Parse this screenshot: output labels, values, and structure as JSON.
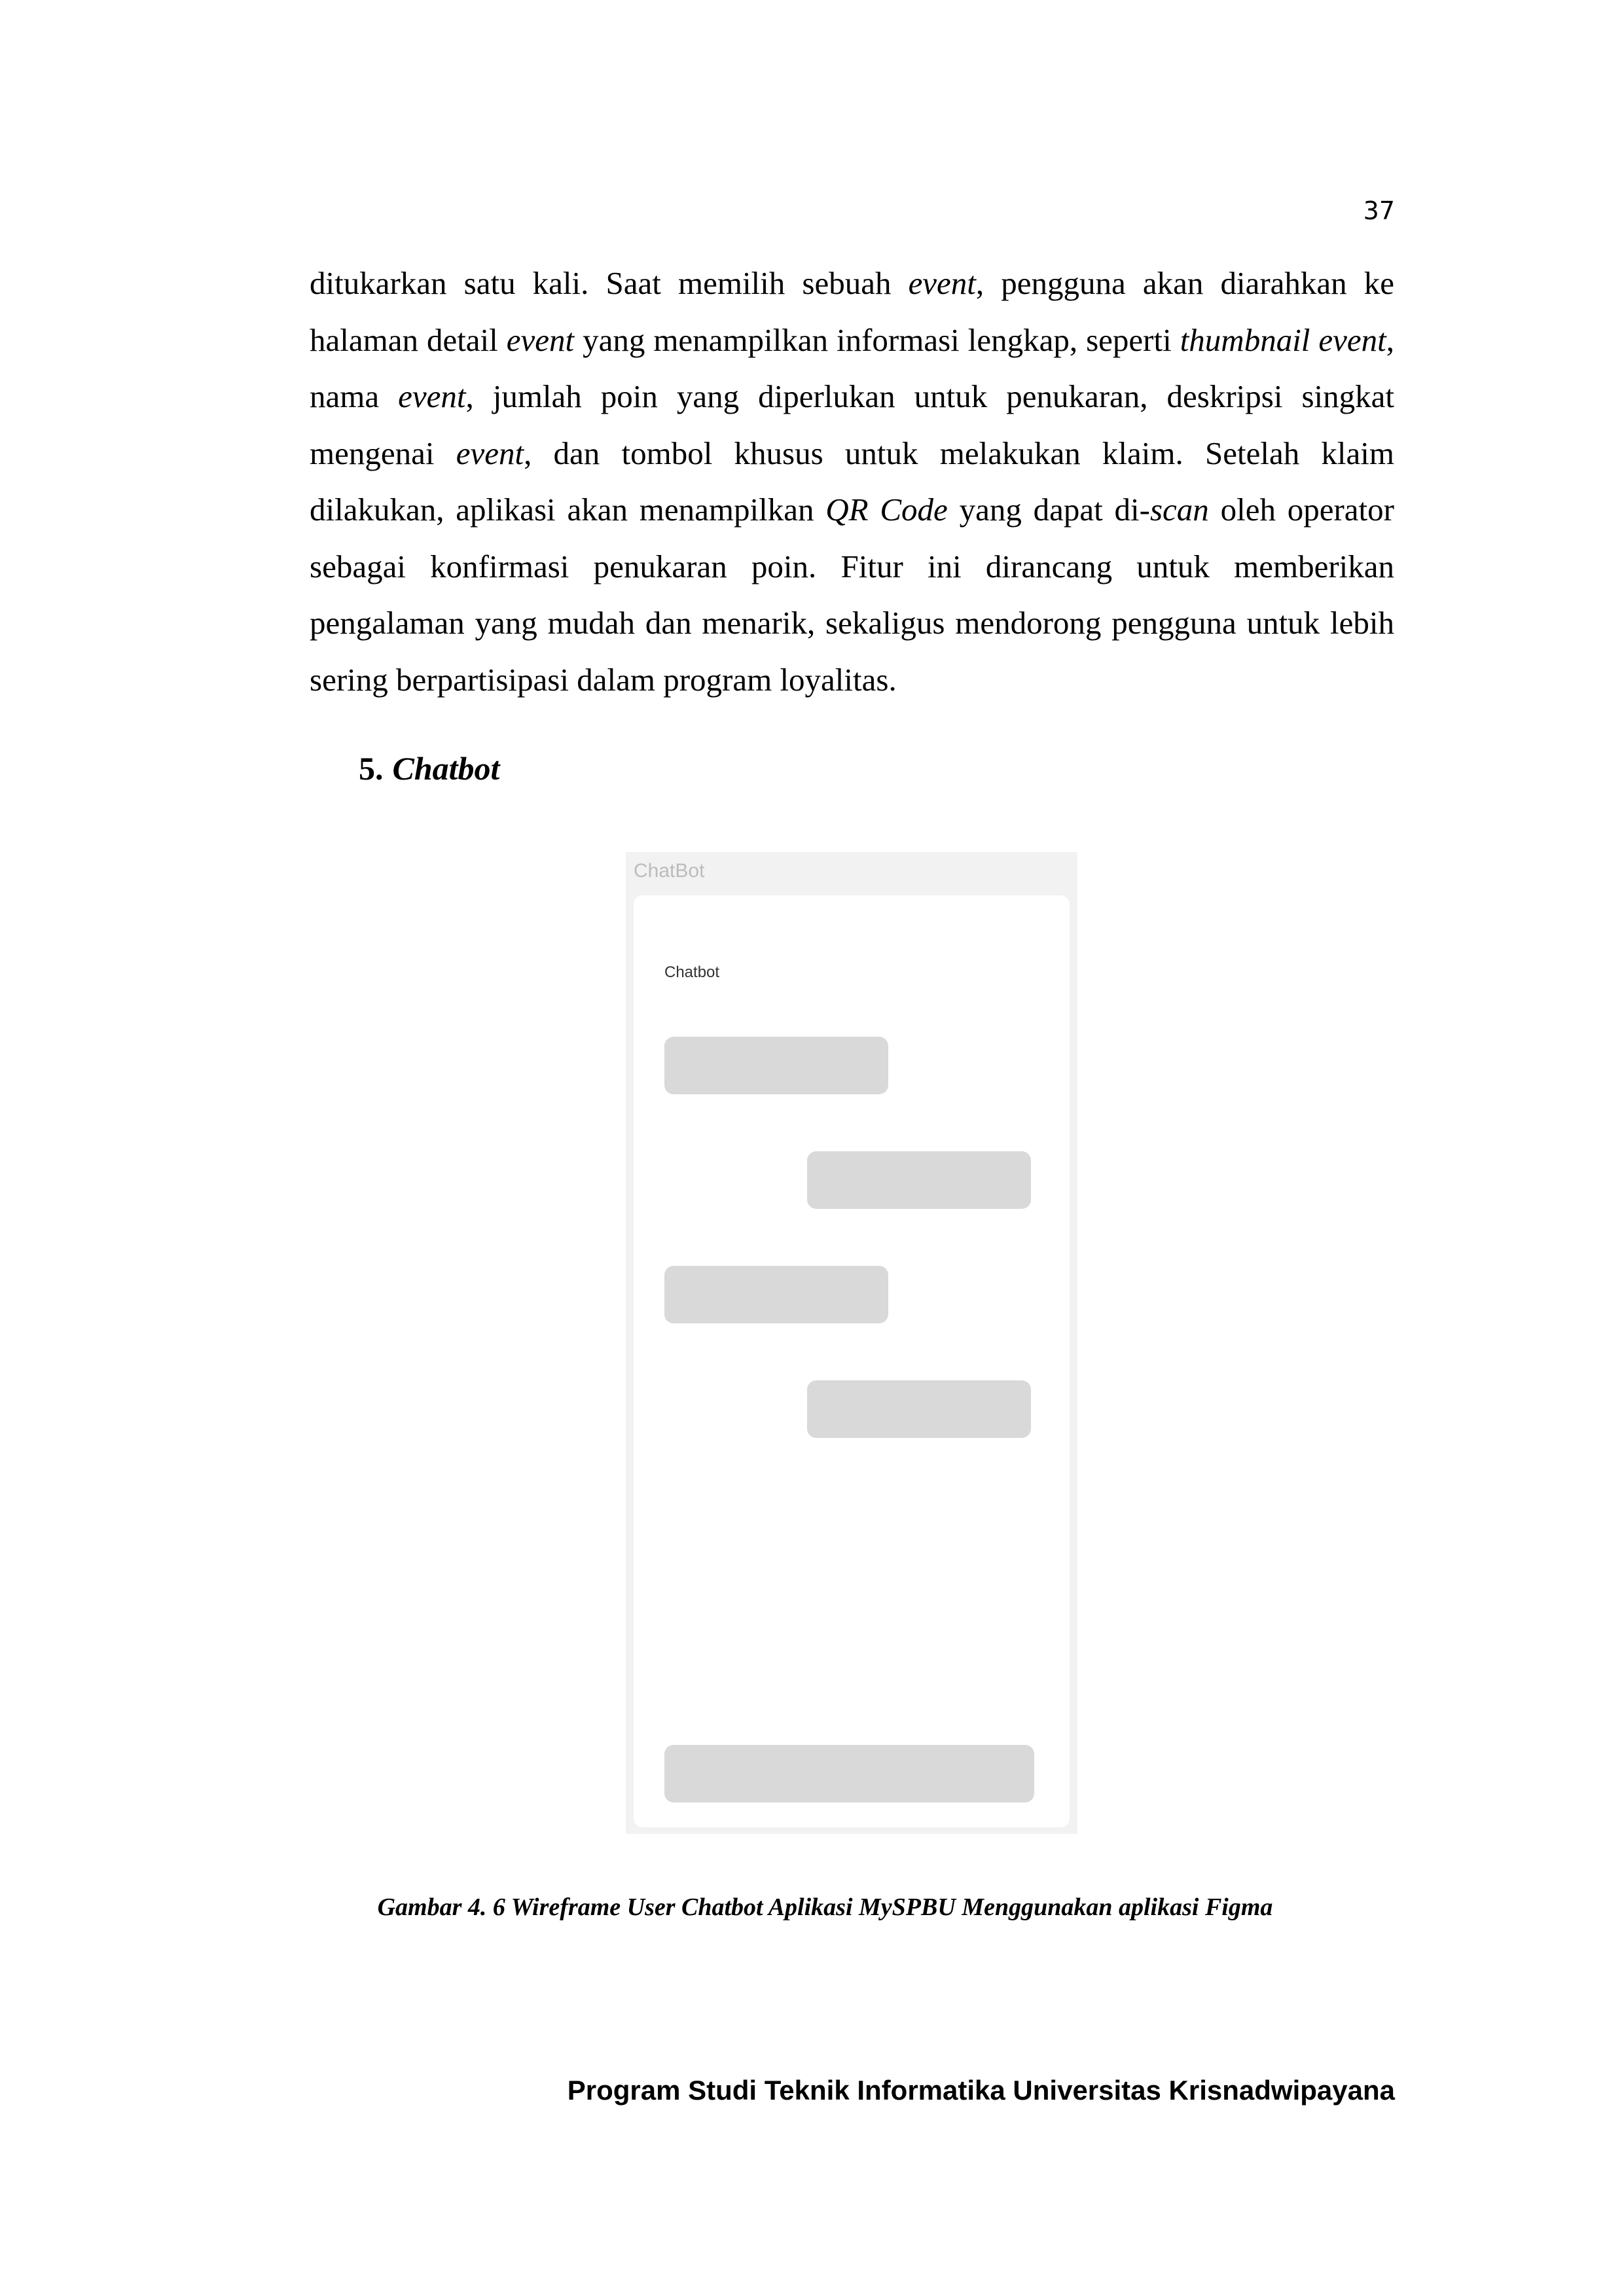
{
  "page_number": "37",
  "paragraph": [
    {
      "t": "ditukarkan satu kali. Saat memilih sebuah ",
      "i": false
    },
    {
      "t": "event",
      "i": true
    },
    {
      "t": ", pengguna akan diarahkan ke halaman detail ",
      "i": false
    },
    {
      "t": "event",
      "i": true
    },
    {
      "t": " yang menampilkan informasi lengkap, seperti ",
      "i": false
    },
    {
      "t": "thumbnail event",
      "i": true
    },
    {
      "t": ", nama ",
      "i": false
    },
    {
      "t": "event",
      "i": true
    },
    {
      "t": ", jumlah poin yang diperlukan untuk penukaran, deskripsi singkat mengenai ",
      "i": false
    },
    {
      "t": "event",
      "i": true
    },
    {
      "t": ", dan tombol khusus untuk melakukan klaim. Setelah klaim dilakukan, aplikasi akan menampilkan ",
      "i": false
    },
    {
      "t": "QR Code",
      "i": true
    },
    {
      "t": " yang dapat di-",
      "i": false
    },
    {
      "t": "scan",
      "i": true
    },
    {
      "t": " oleh operator sebagai konfirmasi penukaran poin. Fitur ini dirancang untuk memberikan pengalaman yang mudah dan menarik, sekaligus mendorong pengguna untuk lebih sering berpartisipasi dalam program loyalitas.",
      "i": false
    }
  ],
  "section": {
    "number": "5.",
    "title": "Chatbot"
  },
  "wireframe": {
    "frame_label": "ChatBot",
    "screen_title": "Chatbot"
  },
  "caption": "Gambar 4. 6 Wireframe User Chatbot Aplikasi MySPBU Menggunakan aplikasi Figma",
  "footer": "Program Studi Teknik Informatika Universitas Krisnadwipayana"
}
